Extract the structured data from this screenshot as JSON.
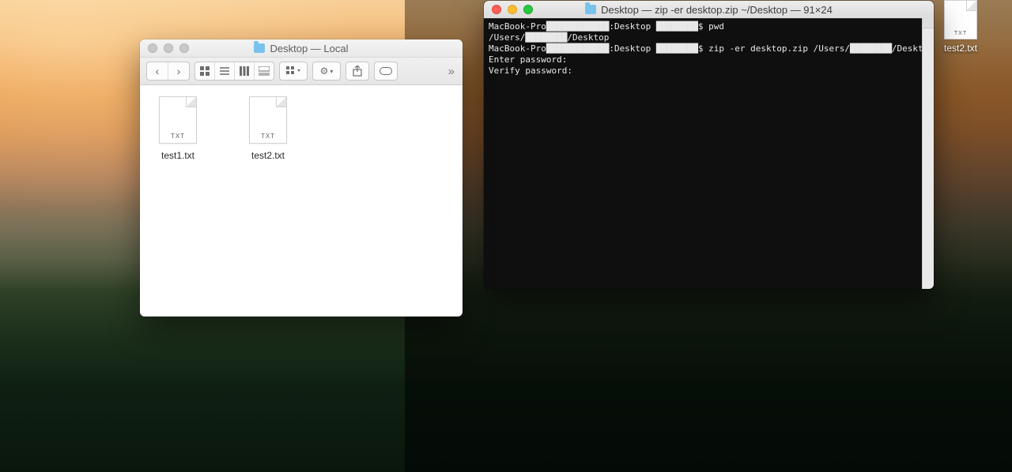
{
  "finder": {
    "title_folder": "Desktop",
    "title_suffix": " — Local",
    "files": [
      {
        "name": "test1.txt",
        "ext": "TXT"
      },
      {
        "name": "test2.txt",
        "ext": "TXT"
      }
    ]
  },
  "terminal": {
    "title": "Desktop — zip -er desktop.zip ~/Desktop — 91×24",
    "lines": [
      "MacBook-Pro████████████:Desktop ████████$ pwd",
      "/Users/████████/Desktop",
      "MacBook-Pro████████████:Desktop ████████$ zip -er desktop.zip /Users/████████/Desktop/",
      "Enter password:",
      "Verify password:"
    ]
  },
  "desktop": {
    "file_name": "test2.txt",
    "file_ext": "TXT"
  }
}
